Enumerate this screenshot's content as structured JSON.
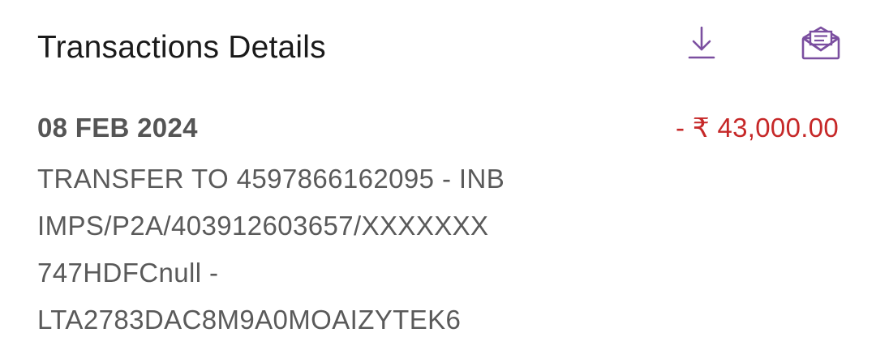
{
  "header": {
    "title": "Transactions Details",
    "download_icon": "download-icon",
    "email_icon": "email-icon",
    "icon_color": "#7b4fa0"
  },
  "transaction": {
    "date": "08 FEB 2024",
    "amount": "- ₹  43,000.00",
    "amount_color": "#c62828",
    "description_lines": [
      "TRANSFER TO 4597866162095 - INB",
      "IMPS/P2A/403912603657/XXXXXXX",
      "747HDFCnull -",
      "LTA2783DAC8M9A0MOAIZYTEK6"
    ]
  }
}
